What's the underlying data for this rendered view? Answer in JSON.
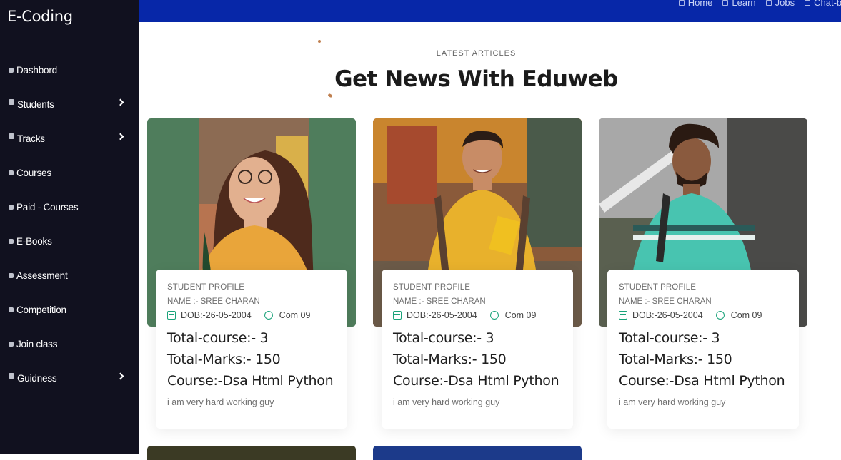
{
  "app": {
    "brand": "E-Coding"
  },
  "sidebar": {
    "items": [
      {
        "label": "Dashbord",
        "icon": "dashboard-icon",
        "has_submenu": false
      },
      {
        "label": "Students",
        "icon": "students-icon",
        "has_submenu": true
      },
      {
        "label": "Tracks",
        "icon": "tracks-icon",
        "has_submenu": true
      },
      {
        "label": "Courses",
        "icon": "courses-icon",
        "has_submenu": false
      },
      {
        "label": "Paid - Courses",
        "icon": "paid-courses-icon",
        "has_submenu": false
      },
      {
        "label": "E-Books",
        "icon": "ebooks-icon",
        "has_submenu": false
      },
      {
        "label": "Assessment",
        "icon": "assessment-icon",
        "has_submenu": false
      },
      {
        "label": "Competition",
        "icon": "competition-icon",
        "has_submenu": false
      },
      {
        "label": "Join class",
        "icon": "join-class-icon",
        "has_submenu": false
      },
      {
        "label": "Guidness",
        "icon": "guidance-icon",
        "has_submenu": true
      }
    ]
  },
  "topnav": {
    "links": [
      {
        "label": "Home",
        "icon": "home-icon"
      },
      {
        "label": "Learn",
        "icon": "learn-icon"
      },
      {
        "label": "Jobs",
        "icon": "jobs-icon"
      },
      {
        "label": "Chat-bot",
        "icon": "chat-bot-icon"
      }
    ]
  },
  "section": {
    "eyebrow": "LATEST ARTICLES",
    "title": "Get News With Eduweb"
  },
  "cards": [
    {
      "kind": "STUDENT PROFILE",
      "name": "NAME :- SREE CHARAN",
      "dob": "DOB:-26-05-2004",
      "comments": "Com 09",
      "total_course": "Total-course:- 3",
      "total_marks": "Total-Marks:- 150",
      "course": "Course:-Dsa Html Python",
      "description": "i am very hard working guy",
      "photo_bg": "#4f7d5c"
    },
    {
      "kind": "STUDENT PROFILE",
      "name": "NAME :- SREE CHARAN",
      "dob": "DOB:-26-05-2004",
      "comments": "Com 09",
      "total_course": "Total-course:- 3",
      "total_marks": "Total-Marks:- 150",
      "course": "Course:-Dsa Html Python",
      "description": "i am very hard working guy",
      "photo_bg": "#8a5a3a"
    },
    {
      "kind": "STUDENT PROFILE",
      "name": "NAME :- SREE CHARAN",
      "dob": "DOB:-26-05-2004",
      "comments": "Com 09",
      "total_course": "Total-course:- 3",
      "total_marks": "Total-Marks:- 150",
      "course": "Course:-Dsa Html Python",
      "description": "i am very hard working guy",
      "photo_bg": "#6d6d6d"
    }
  ],
  "colors": {
    "sidebar_bg": "#11111f",
    "topbar_bg": "#0727a8",
    "accent_green": "#1aa37a"
  }
}
